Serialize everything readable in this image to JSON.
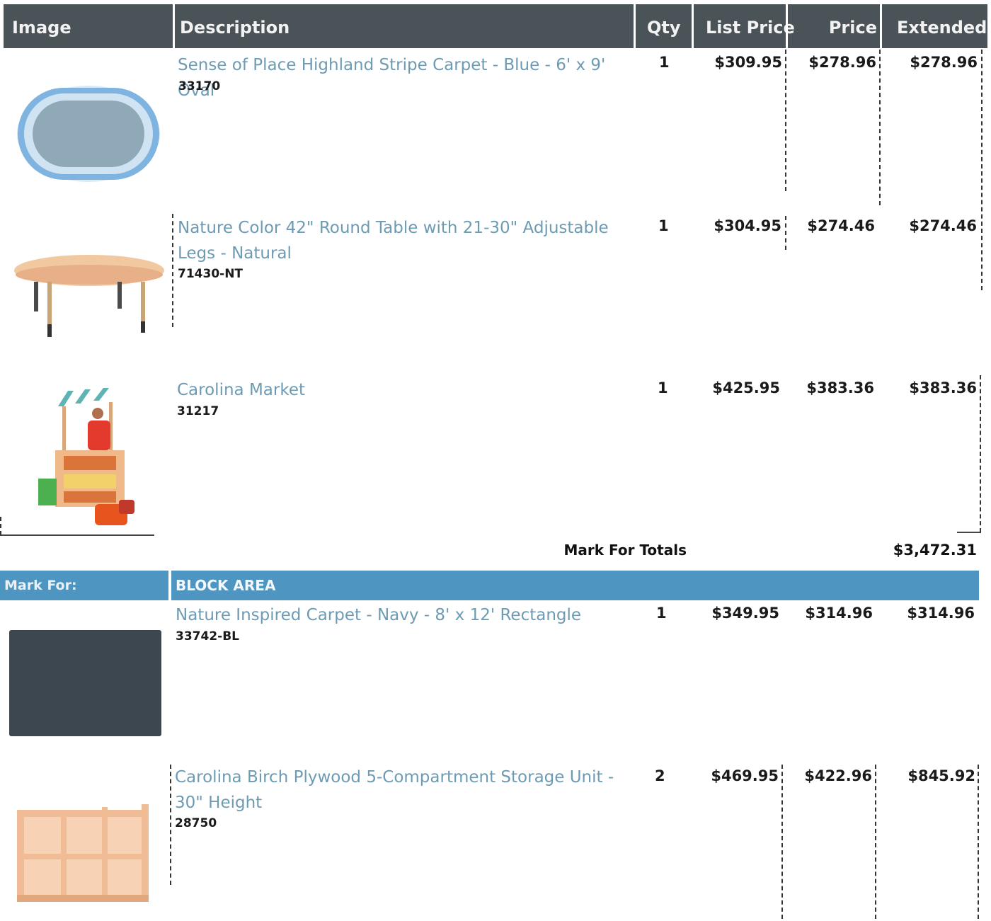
{
  "header": {
    "image": "Image",
    "description": "Description",
    "qty": "Qty",
    "list_price": "List Price",
    "price": "Price",
    "extended": "Extended"
  },
  "items": [
    {
      "description": "Sense of Place Highland Stripe Carpet - Blue - 6' x 9' Oval",
      "sku": "33170",
      "qty": "1",
      "list_price": "$309.95",
      "price": "$278.96",
      "extended": "$278.96",
      "image": "blue-oval-carpet"
    },
    {
      "description": "Nature Color 42\" Round Table with 21-30\" Adjustable Legs - Natural",
      "sku": "71430-NT",
      "qty": "1",
      "list_price": "$304.95",
      "price": "$274.46",
      "extended": "$274.46",
      "image": "round-table"
    },
    {
      "description": "Carolina Market",
      "sku": "31217",
      "qty": "1",
      "list_price": "$425.95",
      "price": "$383.36",
      "extended": "$383.36",
      "image": "market-stand"
    }
  ],
  "totals": {
    "label": "Mark For Totals",
    "value": "$3,472.31"
  },
  "mark_for": {
    "label": "Mark For:",
    "value": "BLOCK AREA"
  },
  "items2": [
    {
      "description": "Nature Inspired Carpet - Navy - 8' x 12' Rectangle",
      "sku": "33742-BL",
      "qty": "1",
      "list_price": "$349.95",
      "price": "$314.96",
      "extended": "$314.96",
      "image": "navy-rectangle-carpet"
    },
    {
      "description": "Carolina Birch Plywood 5-Compartment Storage Unit - 30\" Height",
      "sku": "28750",
      "qty": "2",
      "list_price": "$469.95",
      "price": "$422.96",
      "extended": "$845.92",
      "image": "storage-unit"
    }
  ],
  "colors": {
    "header_bg": "#4a5358",
    "mark_bar": "#4e95c2",
    "link_text": "#6d9bb4"
  }
}
